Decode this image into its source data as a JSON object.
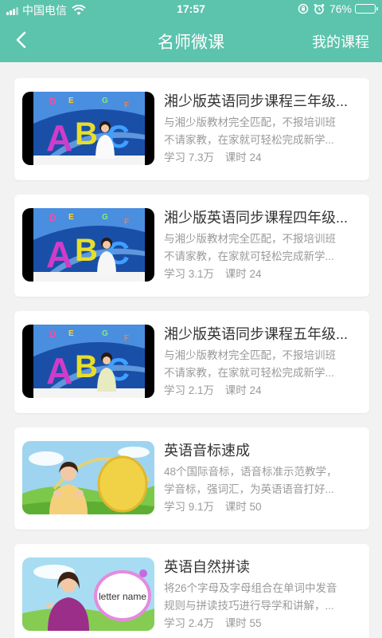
{
  "status_bar": {
    "carrier": "中国电信",
    "time": "17:57",
    "battery_percent": "76%",
    "battery_level": 0.76
  },
  "nav": {
    "title": "名师微课",
    "right_label": "我的课程"
  },
  "courses": [
    {
      "title": "湘少版英语同步课程三年级...",
      "desc_line1": "与湘少版教材完全匹配，不报培训班",
      "desc_line2": "不请家教，在家就可轻松完成新学...",
      "learners": "学习 7.3万",
      "lessons": "课时 24",
      "thumb_type": "abc"
    },
    {
      "title": "湘少版英语同步课程四年级...",
      "desc_line1": "与湘少版教材完全匹配，不报培训班",
      "desc_line2": "不请家教，在家就可轻松完成新学...",
      "learners": "学习 3.1万",
      "lessons": "课时 24",
      "thumb_type": "abc"
    },
    {
      "title": "湘少版英语同步课程五年级...",
      "desc_line1": "与湘少版教材完全匹配，不报培训班",
      "desc_line2": "不请家教，在家就可轻松完成新学...",
      "learners": "学习 2.1万",
      "lessons": "课时 24",
      "thumb_type": "abc"
    },
    {
      "title": "英语音标速成",
      "desc_line1": "48个国际音标，语音标准示范教学，",
      "desc_line2": "学音标，强词汇，为英语语音打好...",
      "learners": "学习 9.1万",
      "lessons": "课时 50",
      "thumb_type": "phonetics"
    },
    {
      "title": "英语自然拼读",
      "desc_line1": "将26个字母及字母组合在单词中发音",
      "desc_line2": "规则与拼读技巧进行导学和讲解，...",
      "learners": "学习 2.4万",
      "lessons": "课时 55",
      "thumb_type": "phonics",
      "thumb_caption": "letter name"
    }
  ],
  "colors": {
    "primary": "#5cc3ad",
    "battery": "#f5c23c",
    "background": "#f2f2f2"
  }
}
